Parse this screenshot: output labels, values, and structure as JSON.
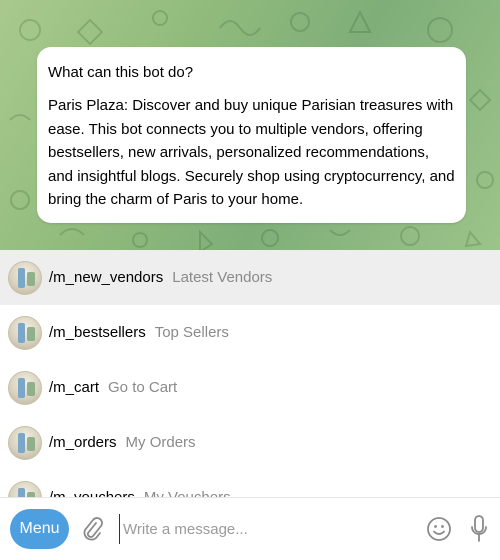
{
  "bot_info": {
    "title": "What can this bot do?",
    "description": "Paris Plaza: Discover and buy unique Parisian treasures with ease. This bot connects you to multiple vendors, offering bestsellers, new arrivals, personalized recommendations, and insightful blogs. Securely shop using cryptocurrency, and bring the charm of Paris to your home."
  },
  "commands": [
    {
      "name": "/m_new_vendors",
      "description": "Latest Vendors",
      "highlighted": true
    },
    {
      "name": "/m_bestsellers",
      "description": "Top Sellers"
    },
    {
      "name": "/m_cart",
      "description": "Go to Cart"
    },
    {
      "name": "/m_orders",
      "description": "My Orders"
    },
    {
      "name": "/m_vouchers",
      "description": "My Vouchers"
    }
  ],
  "composer": {
    "menu_label": "Menu",
    "placeholder": "Write a message...",
    "value": ""
  },
  "colors": {
    "menu_button": "#4e9fe0",
    "wallpaper": "#8fba7c",
    "highlight_row": "#eeeeee"
  },
  "icons": {
    "attach": "paperclip-icon",
    "emoji": "emoji-icon",
    "mic": "microphone-icon"
  }
}
